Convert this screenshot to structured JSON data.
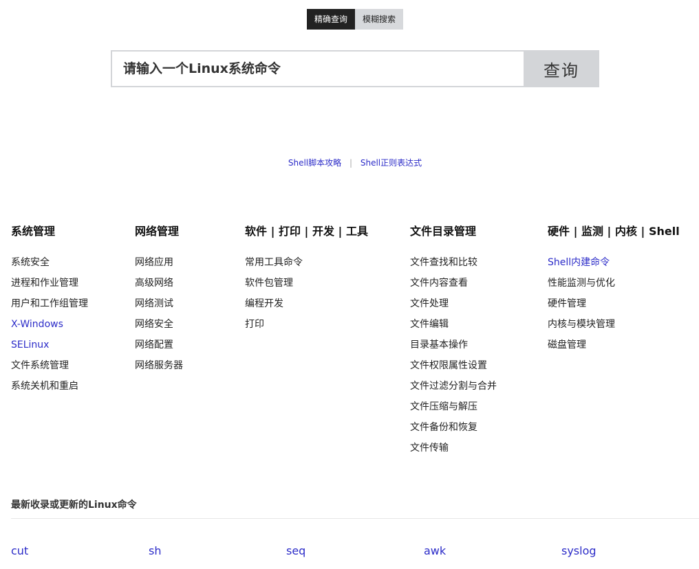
{
  "search_modes": [
    {
      "label": "精确查询",
      "active": true
    },
    {
      "label": "模糊搜索",
      "active": false
    }
  ],
  "search": {
    "placeholder": "请输入一个Linux系统命令",
    "button_label": "查询"
  },
  "quick_links": [
    {
      "label": "Shell脚本攻略"
    },
    {
      "separator": "|"
    },
    {
      "label": "Shell正则表达式"
    }
  ],
  "categories": [
    {
      "title": "系统管理",
      "items": [
        "系统安全",
        "进程和作业管理",
        "用户和工作组管理",
        "X-Windows",
        "SELinux",
        "文件系统管理",
        "系统关机和重启"
      ]
    },
    {
      "title": "网络管理",
      "items": [
        "网络应用",
        "高级网络",
        "网络测试",
        "网络安全",
        "网络配置",
        "网络服务器"
      ]
    },
    {
      "title": "软件 | 打印 | 开发 | 工具",
      "items": [
        "常用工具命令",
        "软件包管理",
        "编程开发",
        "打印"
      ]
    },
    {
      "title": "文件目录管理",
      "items": [
        "文件查找和比较",
        "文件内容查看",
        "文件处理",
        "文件编辑",
        "目录基本操作",
        "文件权限属性设置",
        "文件过滤分割与合并",
        "文件压缩与解压",
        "文件备份和恢复",
        "文件传输"
      ]
    },
    {
      "title": "硬件 | 监测 | 内核 | Shell",
      "items": [
        "Shell内建命令",
        "性能监测与优化",
        "硬件管理",
        "内核与模块管理",
        "磁盘管理"
      ]
    }
  ],
  "recent": {
    "title": "最新收录或更新的Linux命令",
    "commands": [
      "cut",
      "sh",
      "seq",
      "awk",
      "syslog"
    ]
  },
  "colors": {
    "link_blue": "#2b2bc8",
    "active_tab_bg": "#222222",
    "inactive_tab_bg": "#d7d9dc",
    "search_border": "#d3d5d8"
  }
}
